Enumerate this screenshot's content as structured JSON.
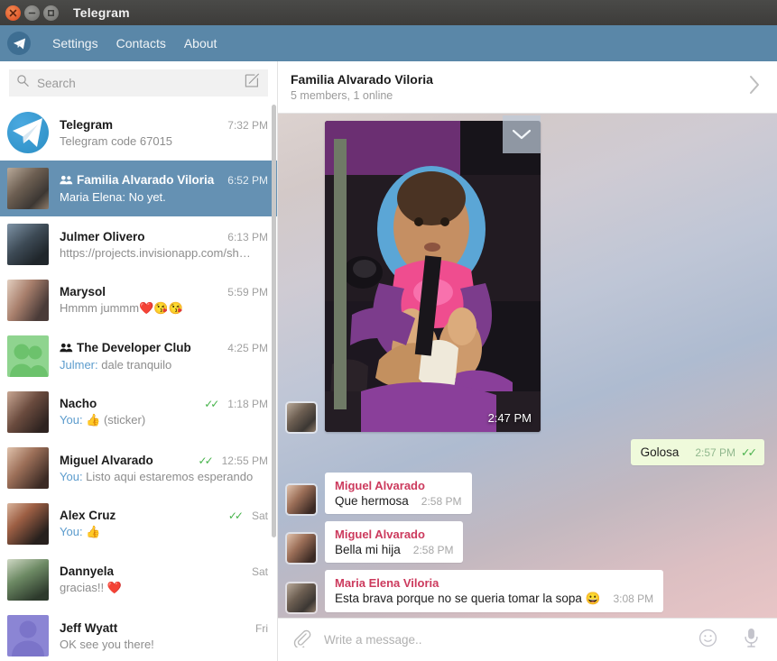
{
  "window": {
    "title": "Telegram",
    "buttons": {
      "close": "close-button",
      "minimize": "minimize-button",
      "maximize": "maximize-button"
    }
  },
  "menu": {
    "logo": "telegram-paper-plane-logo",
    "items": [
      {
        "label": "Settings"
      },
      {
        "label": "Contacts"
      },
      {
        "label": "About"
      }
    ]
  },
  "search": {
    "placeholder": "Search",
    "value": "",
    "icon": "search-icon",
    "compose_icon": "compose-pencil-icon"
  },
  "chat_list": [
    {
      "name": "Telegram",
      "time": "7:32 PM",
      "preview": "Telegram code 67015",
      "prefix": "",
      "selected": false,
      "group": false,
      "ticks": false,
      "avatar_class": "av-tg round"
    },
    {
      "name": "Familia Alvarado Viloria",
      "time": "6:52 PM",
      "preview": "Maria Elena: No yet.",
      "prefix": "",
      "selected": true,
      "group": true,
      "ticks": false,
      "avatar_class": "av-a"
    },
    {
      "name": "Julmer Olivero",
      "time": "6:13 PM",
      "preview": "https://projects.invisionapp.com/sh…",
      "prefix": "",
      "selected": false,
      "group": false,
      "ticks": false,
      "avatar_class": "av-b"
    },
    {
      "name": "Marysol",
      "time": "5:59 PM",
      "preview": "Hmmm jummm❤️😘😘",
      "prefix": "",
      "selected": false,
      "group": false,
      "ticks": false,
      "avatar_class": "av-c"
    },
    {
      "name": "The Developer Club",
      "time": "4:25 PM",
      "preview": "dale tranquilo",
      "prefix": "Julmer: ",
      "selected": false,
      "group": true,
      "ticks": false,
      "avatar_class": "av-d"
    },
    {
      "name": "Nacho",
      "time": "1:18 PM",
      "preview": "👍 (sticker)",
      "prefix": "You: ",
      "selected": false,
      "group": false,
      "ticks": true,
      "avatar_class": "av-e"
    },
    {
      "name": "Miguel Alvarado",
      "time": "12:55 PM",
      "preview": "Listo aqui estaremos esperando",
      "prefix": "You: ",
      "selected": false,
      "group": false,
      "ticks": true,
      "avatar_class": "av-f"
    },
    {
      "name": "Alex Cruz",
      "time": "Sat",
      "preview": "👍",
      "prefix": "You: ",
      "selected": false,
      "group": false,
      "ticks": true,
      "avatar_class": "av-g"
    },
    {
      "name": "Dannyela",
      "time": "Sat",
      "preview": "gracias!! ❤️",
      "prefix": "",
      "selected": false,
      "group": false,
      "ticks": false,
      "avatar_class": "av-h"
    },
    {
      "name": "Jeff Wyatt",
      "time": "Fri",
      "preview": "OK see you there!",
      "prefix": "",
      "selected": false,
      "group": false,
      "ticks": false,
      "avatar_class": "av-i"
    }
  ],
  "chat_header": {
    "title": "Familia Alvarado Viloria",
    "subtitle": "5 members, 1 online",
    "chevron_icon": "chevron-right-icon"
  },
  "messages": [
    {
      "kind": "photo",
      "direction": "in",
      "time": "2:47 PM",
      "avatar_class": "av-a"
    },
    {
      "kind": "text",
      "direction": "out",
      "text": "Golosa",
      "time": "2:57 PM",
      "ticks": "✓✓"
    },
    {
      "kind": "text",
      "direction": "in",
      "sender": "Miguel Alvarado",
      "text": "Que hermosa",
      "time": "2:58 PM",
      "avatar_class": "av-f"
    },
    {
      "kind": "text",
      "direction": "in",
      "sender": "Miguel Alvarado",
      "text": "Bella mi hija",
      "time": "2:58 PM",
      "avatar_class": "av-f"
    },
    {
      "kind": "text",
      "direction": "in",
      "sender": "Maria Elena Viloria",
      "text": "Esta brava porque no se queria tomar la sopa 😀",
      "time": "3:08 PM",
      "avatar_class": "av-a"
    }
  ],
  "scroll_down_button": {
    "icon": "chevron-down-icon"
  },
  "composer": {
    "attach_icon": "paperclip-icon",
    "placeholder": "Write a message..",
    "value": "",
    "emoji_icon": "smiley-face-icon",
    "mic_icon": "microphone-icon"
  },
  "colors": {
    "titlebar": "#423f3d",
    "menubar": "#5a87a8",
    "selected_chat": "#6591b3",
    "accent_link": "#5c9ccd",
    "tick_green": "#46b34a",
    "outgoing_bubble": "#effadb",
    "sender_name": "#cc3a5d"
  }
}
